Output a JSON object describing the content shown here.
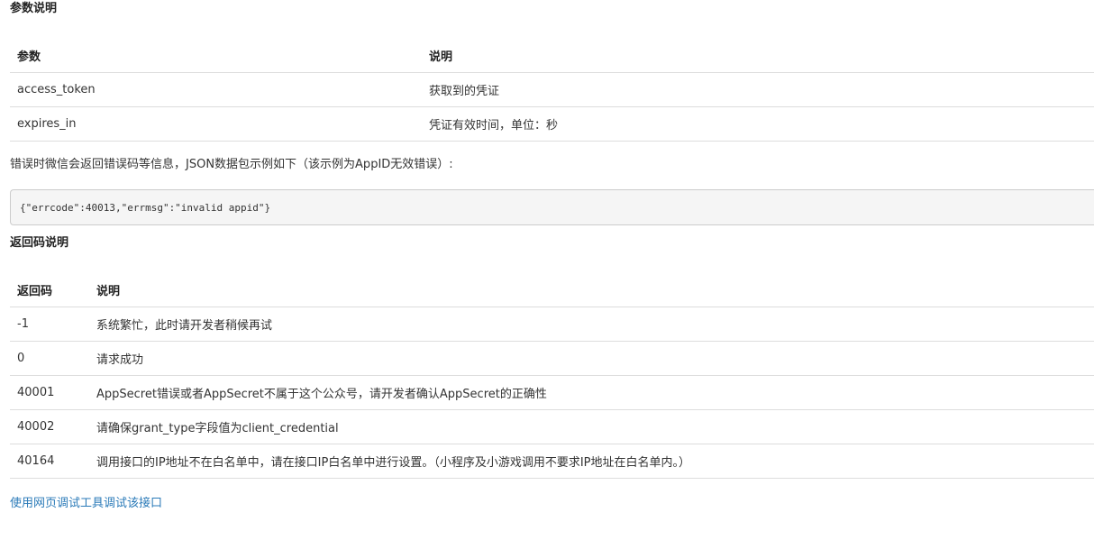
{
  "params_section": {
    "title": "参数说明",
    "headers": [
      "参数",
      "说明"
    ],
    "rows": [
      [
        "access_token",
        "获取到的凭证"
      ],
      [
        "expires_in",
        "凭证有效时间，单位：秒"
      ]
    ]
  },
  "error_intro": "错误时微信会返回错误码等信息，JSON数据包示例如下（该示例为AppID无效错误）:",
  "code_sample": "{\"errcode\":40013,\"errmsg\":\"invalid appid\"}",
  "codes_section": {
    "title": "返回码说明",
    "headers": [
      "返回码",
      "说明"
    ],
    "rows": [
      [
        "-1",
        "系统繁忙，此时请开发者稍候再试"
      ],
      [
        "0",
        "请求成功"
      ],
      [
        "40001",
        "AppSecret错误或者AppSecret不属于这个公众号，请开发者确认AppSecret的正确性"
      ],
      [
        "40002",
        "请确保grant_type字段值为client_credential"
      ],
      [
        "40164",
        "调用接口的IP地址不在白名单中，请在接口IP白名单中进行设置。（小程序及小游戏调用不要求IP地址在白名单内。）"
      ]
    ]
  },
  "debug_link": "使用网页调试工具调试该接口",
  "colors": {
    "link": "#2a7ab8",
    "border": "#dddddd",
    "code_bg": "#f5f5f5"
  }
}
